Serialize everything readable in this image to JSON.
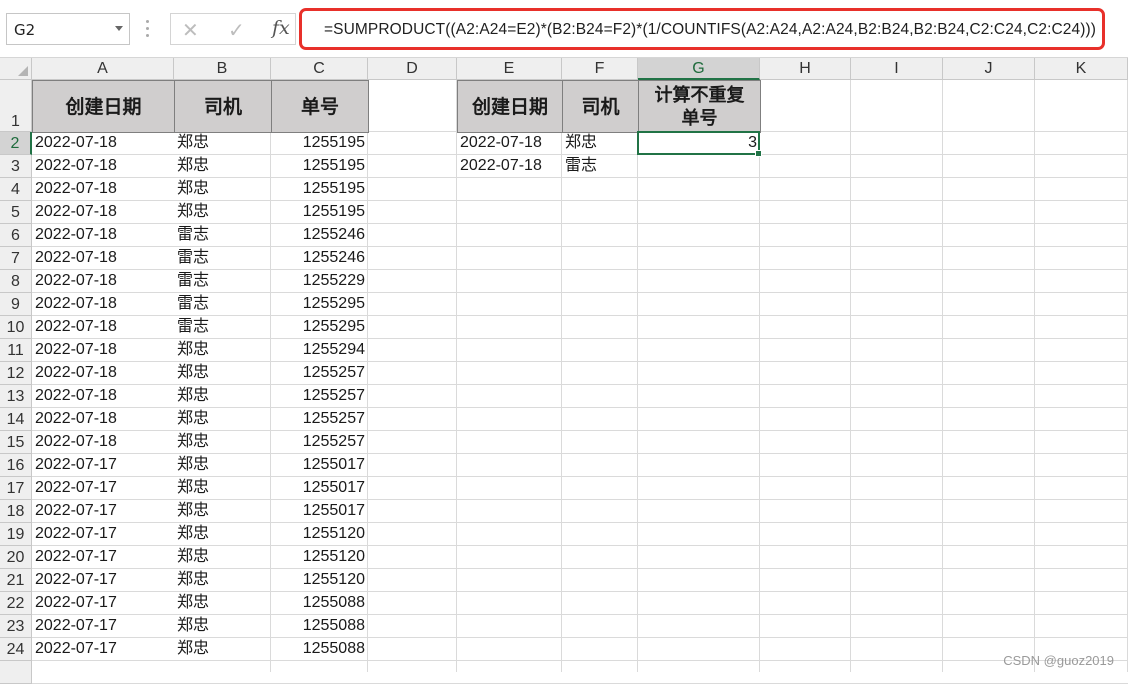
{
  "formula_bar": {
    "name_box": "G2",
    "cancel_icon": "close-icon",
    "enter_icon": "check-icon",
    "fx_label": "fx",
    "formula": "=SUMPRODUCT((A2:A24=E2)*(B2:B24=F2)*(1/COUNTIFS(A2:A24,A2:A24,B2:B24,B2:B24,C2:C24,C2:C24)))",
    "highlight_color": "#e8302a"
  },
  "columns": [
    "A",
    "B",
    "C",
    "D",
    "E",
    "F",
    "G",
    "H",
    "I",
    "J",
    "K"
  ],
  "selected_column": "G",
  "selected_row": "2",
  "rows": [
    "1",
    "2",
    "3",
    "4",
    "5",
    "6",
    "7",
    "8",
    "9",
    "10",
    "11",
    "12",
    "13",
    "14",
    "15",
    "16",
    "17",
    "18",
    "19",
    "20",
    "21",
    "22",
    "23",
    "24",
    ""
  ],
  "table_left": {
    "headers": [
      "创建日期",
      "司机",
      "单号"
    ],
    "rows": [
      [
        "2022-07-18",
        "郑忠",
        "1255195"
      ],
      [
        "2022-07-18",
        "郑忠",
        "1255195"
      ],
      [
        "2022-07-18",
        "郑忠",
        "1255195"
      ],
      [
        "2022-07-18",
        "郑忠",
        "1255195"
      ],
      [
        "2022-07-18",
        "雷志",
        "1255246"
      ],
      [
        "2022-07-18",
        "雷志",
        "1255246"
      ],
      [
        "2022-07-18",
        "雷志",
        "1255229"
      ],
      [
        "2022-07-18",
        "雷志",
        "1255295"
      ],
      [
        "2022-07-18",
        "雷志",
        "1255295"
      ],
      [
        "2022-07-18",
        "郑忠",
        "1255294"
      ],
      [
        "2022-07-18",
        "郑忠",
        "1255257"
      ],
      [
        "2022-07-18",
        "郑忠",
        "1255257"
      ],
      [
        "2022-07-18",
        "郑忠",
        "1255257"
      ],
      [
        "2022-07-18",
        "郑忠",
        "1255257"
      ],
      [
        "2022-07-17",
        "郑忠",
        "1255017"
      ],
      [
        "2022-07-17",
        "郑忠",
        "1255017"
      ],
      [
        "2022-07-17",
        "郑忠",
        "1255017"
      ],
      [
        "2022-07-17",
        "郑忠",
        "1255120"
      ],
      [
        "2022-07-17",
        "郑忠",
        "1255120"
      ],
      [
        "2022-07-17",
        "郑忠",
        "1255120"
      ],
      [
        "2022-07-17",
        "郑忠",
        "1255088"
      ],
      [
        "2022-07-17",
        "郑忠",
        "1255088"
      ],
      [
        "2022-07-17",
        "郑忠",
        "1255088"
      ]
    ]
  },
  "table_right": {
    "headers": [
      "创建日期",
      "司机",
      "计算不重复单号"
    ],
    "rows": [
      [
        "2022-07-18",
        "郑忠",
        "3"
      ],
      [
        "2022-07-18",
        "雷志",
        ""
      ]
    ]
  },
  "watermark": "CSDN @guoz2019"
}
